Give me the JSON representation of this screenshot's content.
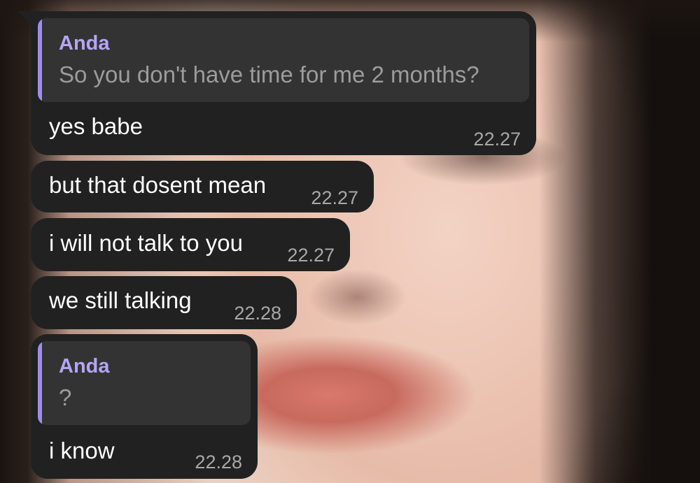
{
  "chat": {
    "messages": [
      {
        "reply": {
          "author": "Anda",
          "text": "So you don't have time for me 2 months?"
        },
        "text": "yes babe",
        "time": "22.27"
      },
      {
        "text": "but that dosent mean",
        "time": "22.27"
      },
      {
        "text": "i will not talk to you",
        "time": "22.27"
      },
      {
        "text": "we still talking",
        "time": "22.28"
      },
      {
        "reply": {
          "author": "Anda",
          "text": "?"
        },
        "text": "i know",
        "time": "22.28"
      }
    ]
  },
  "colors": {
    "bubble": "#212121",
    "reply_background": "#333333",
    "reply_accent": "#9f8cf0",
    "reply_author": "#b4a5f5",
    "timestamp": "#a8a8a8"
  }
}
